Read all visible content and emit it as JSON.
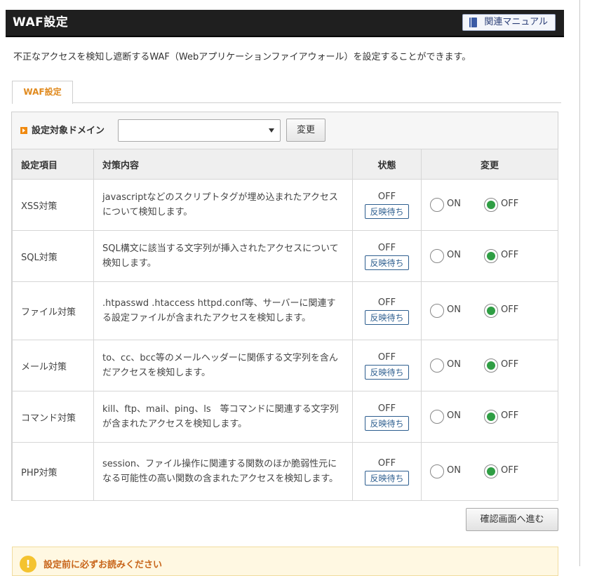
{
  "header": {
    "title": "WAF設定",
    "manual_label": "関連マニュアル"
  },
  "description": "不正なアクセスを検知し遮断するWAF（Webアプリケーションファイアウォール）を設定することができます。",
  "tab": {
    "label": "WAF設定"
  },
  "domain": {
    "label": "設定対象ドメイン",
    "selected": "",
    "change_label": "変更"
  },
  "table": {
    "headers": [
      "設定項目",
      "対策内容",
      "状態",
      "変更"
    ],
    "rows": [
      {
        "item": "XSS対策",
        "content": "javascriptなどのスクリプトタグが埋め込まれたアクセスについて検知します。",
        "status": "OFF",
        "pending": "反映待ち",
        "on_label": "ON",
        "off_label": "OFF",
        "selected": "OFF"
      },
      {
        "item": "SQL対策",
        "content": "SQL構文に該当する文字列が挿入されたアクセスについて検知します。",
        "status": "OFF",
        "pending": "反映待ち",
        "on_label": "ON",
        "off_label": "OFF",
        "selected": "OFF"
      },
      {
        "item": "ファイル対策",
        "content": ".htpasswd .htaccess httpd.conf等、サーバーに関連する設定ファイルが含まれたアクセスを検知します。",
        "status": "OFF",
        "pending": "反映待ち",
        "on_label": "ON",
        "off_label": "OFF",
        "selected": "OFF"
      },
      {
        "item": "メール対策",
        "content": "to、cc、bcc等のメールヘッダーに関係する文字列を含んだアクセスを検知します。",
        "status": "OFF",
        "pending": "反映待ち",
        "on_label": "ON",
        "off_label": "OFF",
        "selected": "OFF"
      },
      {
        "item": "コマンド対策",
        "content": "kill、ftp、mail、ping、ls　等コマンドに関連する文字列が含まれたアクセスを検知します。",
        "status": "OFF",
        "pending": "反映待ち",
        "on_label": "ON",
        "off_label": "OFF",
        "selected": "OFF"
      },
      {
        "item": "PHP対策",
        "content": "session、ファイル操作に関連する関数のほか脆弱性元になる可能性の高い関数の含まれたアクセスを検知します。",
        "status": "OFF",
        "pending": "反映待ち",
        "on_label": "ON",
        "off_label": "OFF",
        "selected": "OFF"
      }
    ]
  },
  "confirm_label": "確認画面へ進む",
  "notice": {
    "icon": "warning-icon",
    "text": "設定前に必ずお読みください"
  },
  "colors": {
    "header_bg": "#1f1f1f",
    "tab_accent": "#e08a1e",
    "radio_checked": "#2f9e44",
    "pending_border": "#2d5e8f"
  }
}
